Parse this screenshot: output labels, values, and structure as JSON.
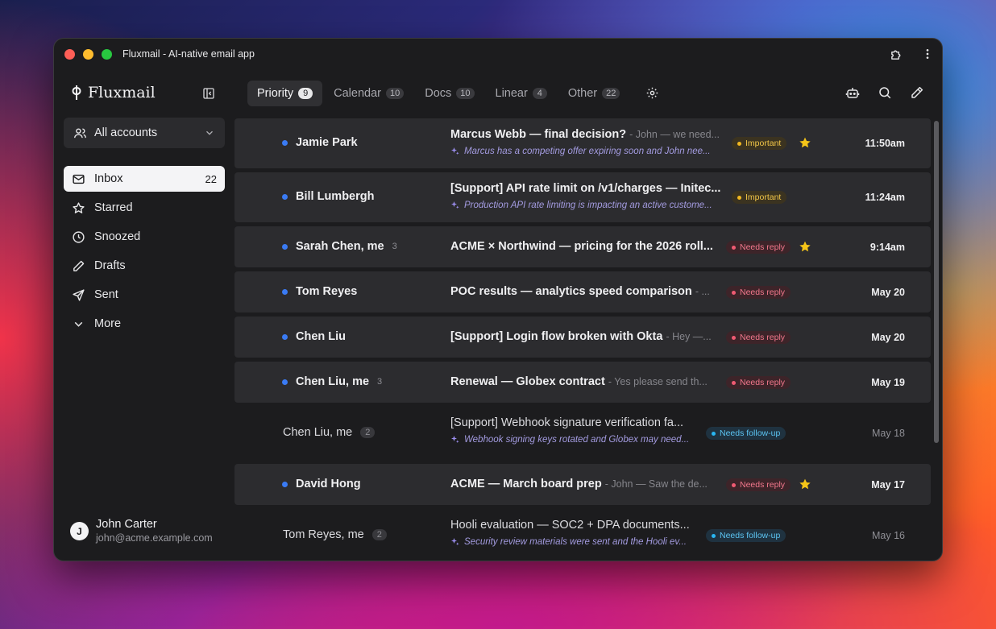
{
  "window": {
    "title": "Fluxmail - AI-native email app"
  },
  "brand": {
    "name": "Fluxmail"
  },
  "accounts": {
    "label": "All accounts"
  },
  "nav": [
    {
      "label": "Inbox",
      "count": "22",
      "icon": "inbox-icon",
      "active": true
    },
    {
      "label": "Starred",
      "count": "",
      "icon": "star-icon"
    },
    {
      "label": "Snoozed",
      "count": "",
      "icon": "clock-icon"
    },
    {
      "label": "Drafts",
      "count": "",
      "icon": "pencil-icon"
    },
    {
      "label": "Sent",
      "count": "",
      "icon": "send-icon"
    },
    {
      "label": "More",
      "count": "",
      "icon": "chevron-down-icon"
    }
  ],
  "user": {
    "name": "John Carter",
    "email": "john@acme.example.com",
    "initial": "J"
  },
  "tabs": [
    {
      "label": "Priority",
      "count": "9",
      "active": true
    },
    {
      "label": "Calendar",
      "count": "10"
    },
    {
      "label": "Docs",
      "count": "10"
    },
    {
      "label": "Linear",
      "count": "4"
    },
    {
      "label": "Other",
      "count": "22"
    }
  ],
  "emails": [
    {
      "sender": "Jamie Park",
      "thread": "",
      "subject": "Marcus Webb — final decision?",
      "snippet": "- John — we need...",
      "summary": "Marcus has a competing offer expiring soon and John nee...",
      "tag": "Important",
      "tag_type": "important",
      "starred": true,
      "date": "11:50am",
      "unread": true,
      "height": 62
    },
    {
      "sender": "Bill Lumbergh",
      "thread": "",
      "subject": "[Support] API rate limit on /v1/charges — Initec...",
      "snippet": "",
      "summary": "Production API rate limiting is impacting an active custome...",
      "tag": "Important",
      "tag_type": "important",
      "starred": false,
      "date": "11:24am",
      "unread": true,
      "height": 62
    },
    {
      "sender": "Sarah Chen, me",
      "thread": "3",
      "subject": "ACME × Northwind — pricing for the 2026 roll...",
      "snippet": "",
      "summary": "",
      "tag": "Needs reply",
      "tag_type": "reply",
      "starred": true,
      "date": "9:14am",
      "unread": true,
      "height": 51
    },
    {
      "sender": "Tom Reyes",
      "thread": "",
      "subject": "POC results — analytics speed comparison",
      "snippet": "- ...",
      "summary": "",
      "tag": "Needs reply",
      "tag_type": "reply",
      "starred": false,
      "date": "May 20",
      "unread": true,
      "height": 51
    },
    {
      "sender": "Chen Liu",
      "thread": "",
      "subject": "[Support] Login flow broken with Okta",
      "snippet": "- Hey —...",
      "summary": "",
      "tag": "Needs reply",
      "tag_type": "reply",
      "starred": false,
      "date": "May 20",
      "unread": true,
      "height": 51
    },
    {
      "sender": "Chen Liu, me",
      "thread": "3",
      "subject": "Renewal — Globex contract",
      "snippet": "- Yes please send th...",
      "summary": "",
      "tag": "Needs reply",
      "tag_type": "reply",
      "starred": false,
      "date": "May 19",
      "unread": true,
      "height": 51
    },
    {
      "sender": "Chen Liu, me",
      "thread": "2",
      "subject": "[Support] Webhook signature verification fa...",
      "snippet": "",
      "summary": "Webhook signing keys rotated and Globex may need...",
      "tag": "Needs follow-up",
      "tag_type": "follow",
      "starred": false,
      "date": "May 18",
      "unread": false,
      "height": 66
    },
    {
      "sender": "David Hong",
      "thread": "",
      "subject": "ACME — March board prep",
      "snippet": "- John — Saw the de...",
      "summary": "",
      "tag": "Needs reply",
      "tag_type": "reply",
      "starred": true,
      "date": "May 17",
      "unread": true,
      "height": 51
    },
    {
      "sender": "Tom Reyes, me",
      "thread": "2",
      "subject": "Hooli evaluation — SOC2 + DPA documents...",
      "snippet": "",
      "summary": "Security review materials were sent and the Hooli ev...",
      "tag": "Needs follow-up",
      "tag_type": "follow",
      "starred": false,
      "date": "May 16",
      "unread": false,
      "height": 66
    }
  ]
}
